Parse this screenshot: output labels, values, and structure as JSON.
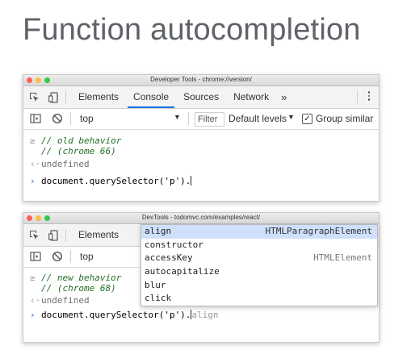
{
  "slide": {
    "title": "Function autocompletion"
  },
  "window1": {
    "title": "Developer Tools - chrome://version/",
    "tabs": {
      "elements": "Elements",
      "console": "Console",
      "sources": "Sources",
      "network": "Network",
      "more": "»"
    },
    "filterbar": {
      "context": "top",
      "filter_placeholder": "Filter",
      "levels": "Default levels",
      "group_similar": "Group similar",
      "group_similar_checked": true
    },
    "console": {
      "comment1": "// old behavior",
      "comment2": "// (chrome 66)",
      "result": "undefined",
      "input": "document.querySelector('p')."
    }
  },
  "window2": {
    "title": "DevTools - todomvc.com/examples/react/",
    "tabs": {
      "elements": "Elements"
    },
    "filterbar": {
      "context": "top"
    },
    "console": {
      "comment1": "// new behavior",
      "comment2": "// (chrome 68)",
      "result": "undefined",
      "input": "document.querySelector('p').",
      "ghost_text": "align"
    },
    "autocomplete": [
      {
        "label": "align",
        "hint": "HTMLParagraphElement",
        "selected": true
      },
      {
        "label": "constructor",
        "hint": ""
      },
      {
        "label": "accessKey",
        "hint": "HTMLElement"
      },
      {
        "label": "autocapitalize",
        "hint": ""
      },
      {
        "label": "blur",
        "hint": ""
      },
      {
        "label": "click",
        "hint": ""
      }
    ]
  },
  "colors": {
    "accent": "#1a73e8",
    "comment": "#236e25",
    "selection": "#cfe0fc"
  },
  "icons": [
    "inspect-icon",
    "device-icon",
    "kebab-menu-icon",
    "sidebar-toggle-icon",
    "clear-console-icon",
    "dropdown-arrow-icon",
    "prompt-chevron-icon",
    "result-arrow-icon"
  ]
}
